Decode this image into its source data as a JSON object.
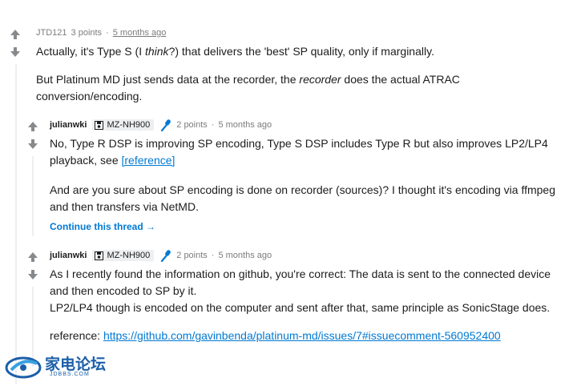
{
  "comments": [
    {
      "user": "JTD121",
      "points": "3 points",
      "time": "5 months ago",
      "para1_a": "Actually, it's Type S (I ",
      "para1_em": "think",
      "para1_b": "?) that delivers the 'best' SP quality, only if marginally.",
      "para2_a": "But Platinum MD just sends data at the recorder, the ",
      "para2_em": "recorder",
      "para2_b": " does the actual ATRAC conversion/encoding."
    },
    {
      "user": "julianwki",
      "flair": "MZ-NH900",
      "points": "2 points",
      "time": "5 months ago",
      "para1_a": "No, Type R DSP is improving SP encoding, Type S DSP includes Type R but also improves LP2/LP4 playback, see ",
      "para1_link": "[reference]",
      "para2": "And are you sure about SP encoding is done on recorder (sources)? I thought it's encoding via ffmpeg and then transfers via NetMD.",
      "continue": "Continue this thread"
    },
    {
      "user": "julianwki",
      "flair": "MZ-NH900",
      "points": "2 points",
      "time": "5 months ago",
      "para1": "As I recently found the information on github, you're correct: The data is sent to the connected device and then encoded to SP by it.",
      "para1b": "LP2/LP4 though is encoded on the computer and sent after that, same principle as SonicStage does.",
      "para2_a": "reference: ",
      "para2_link": "https://github.com/gavinbenda/platinum-md/issues/7#issuecomment-560952400"
    }
  ],
  "separator": "·",
  "continue_arrow": "→",
  "watermark": {
    "text": "家电论坛",
    "sub": "JDBBS.COM"
  },
  "colors": {
    "link": "#0079d3",
    "meta": "#7c7c7c",
    "thread_line": "#edeff1",
    "mic": "#0079d3"
  }
}
